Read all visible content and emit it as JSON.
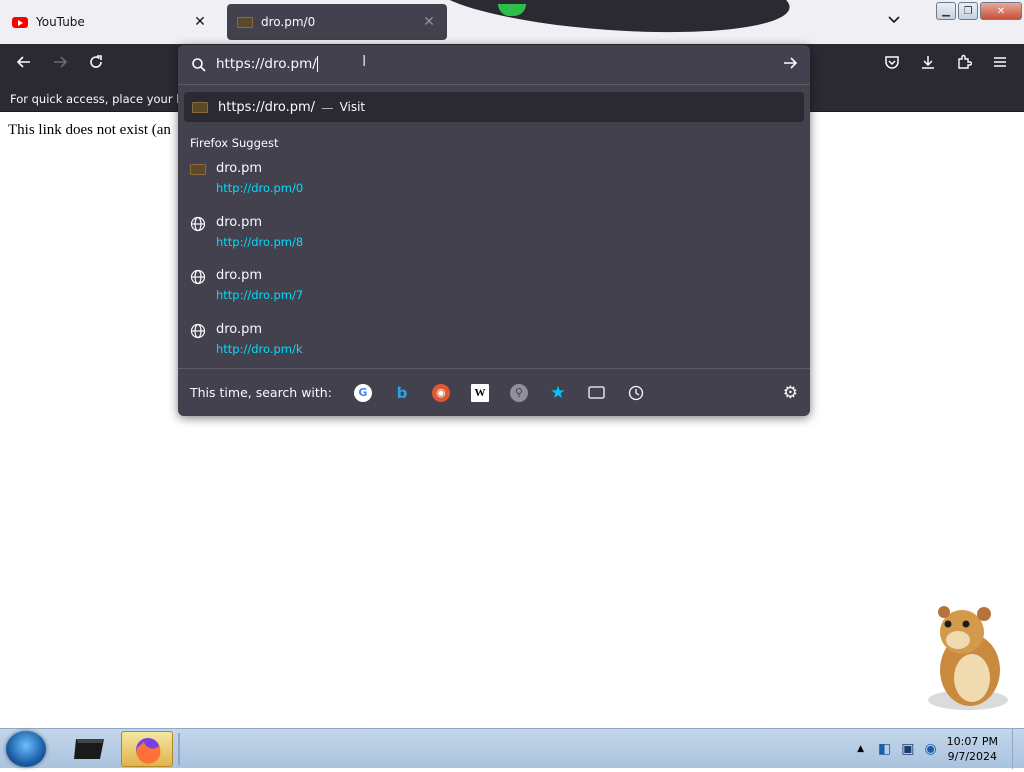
{
  "tabs": [
    {
      "title": "YouTube",
      "active": false
    },
    {
      "title": "dro.pm/0",
      "active": true
    }
  ],
  "bookmarks_bar": {
    "text": "For quick access, place your boo"
  },
  "page": {
    "message": "This link does not exist (an"
  },
  "urlbar": {
    "value": "https://dro.pm/",
    "visit_row": {
      "url": "https://dro.pm/",
      "separator": "—",
      "action": "Visit"
    },
    "section_label": "Firefox Suggest",
    "suggestions": [
      {
        "title": "dro.pm",
        "url": "http://dro.pm/0",
        "icon": "dro-favicon"
      },
      {
        "title": "dro.pm",
        "url": "http://dro.pm/8",
        "icon": "globe-icon"
      },
      {
        "title": "dro.pm",
        "url": "http://dro.pm/7",
        "icon": "globe-icon"
      },
      {
        "title": "dro.pm",
        "url": "http://dro.pm/k",
        "icon": "globe-icon"
      }
    ],
    "search_with_label": "This time, search with:",
    "engines": [
      "google",
      "bing",
      "duckduckgo",
      "wikipedia",
      "search",
      "bookmarks",
      "tabs",
      "history"
    ]
  },
  "taskbar": {
    "time": "10:07 PM",
    "date": "9/7/2024"
  },
  "colors": {
    "chrome_dark": "#2b2a33",
    "panel": "#42414d",
    "link": "#00ddff"
  }
}
